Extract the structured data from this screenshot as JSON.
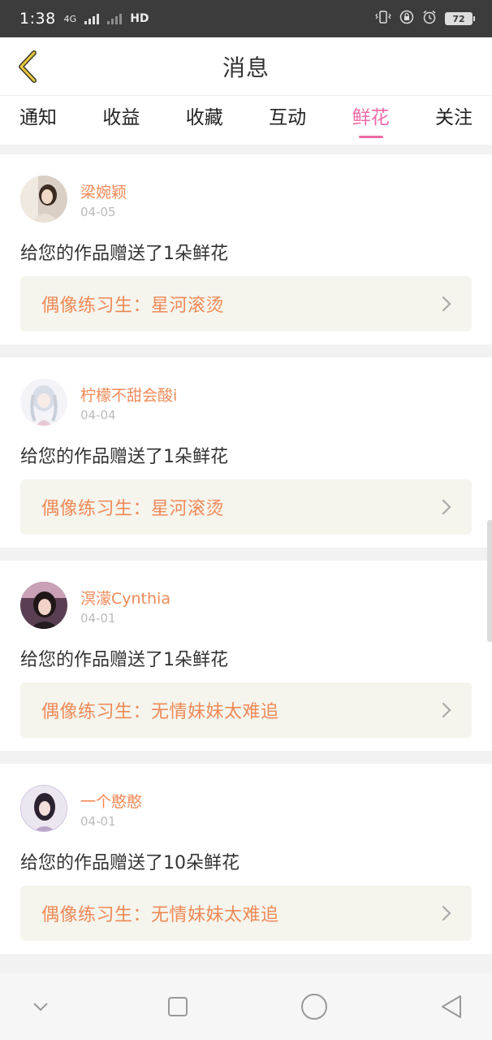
{
  "status_bar": {
    "time": "1:38",
    "network": "4G",
    "hd": "HD",
    "battery": "72"
  },
  "header": {
    "title": "消息"
  },
  "tabs": [
    {
      "label": "通知",
      "active": false
    },
    {
      "label": "收益",
      "active": false
    },
    {
      "label": "收藏",
      "active": false
    },
    {
      "label": "互动",
      "active": false
    },
    {
      "label": "鲜花",
      "active": true
    },
    {
      "label": "关注",
      "active": false
    }
  ],
  "notifications": [
    {
      "username": "梁婉颖",
      "date": "04-05",
      "message": "给您的作品赠送了1朵鲜花",
      "work_title": "偶像练习生：星河滚烫"
    },
    {
      "username": "柠檬不甜会酸i",
      "date": "04-04",
      "message": "给您的作品赠送了1朵鲜花",
      "work_title": "偶像练习生：星河滚烫"
    },
    {
      "username": "溟濛Cynthia",
      "date": "04-01",
      "message": "给您的作品赠送了1朵鲜花",
      "work_title": "偶像练习生：无情妹妹太难追"
    },
    {
      "username": "一个憨憨",
      "date": "04-01",
      "message": "给您的作品赠送了10朵鲜花",
      "work_title": "偶像练习生：无情妹妹太难追"
    }
  ],
  "colors": {
    "accent_pink": "#ee6aa7",
    "accent_orange": "#f08a57",
    "link_bg": "#f5f4ed",
    "back_arrow": "#e8c640"
  },
  "icons": {
    "back": "chevron-left-icon",
    "nav_back": "triangle-back-icon",
    "nav_home": "circle-home-icon",
    "nav_recent": "square-recent-icon",
    "nav_hide": "chevron-down-icon"
  }
}
